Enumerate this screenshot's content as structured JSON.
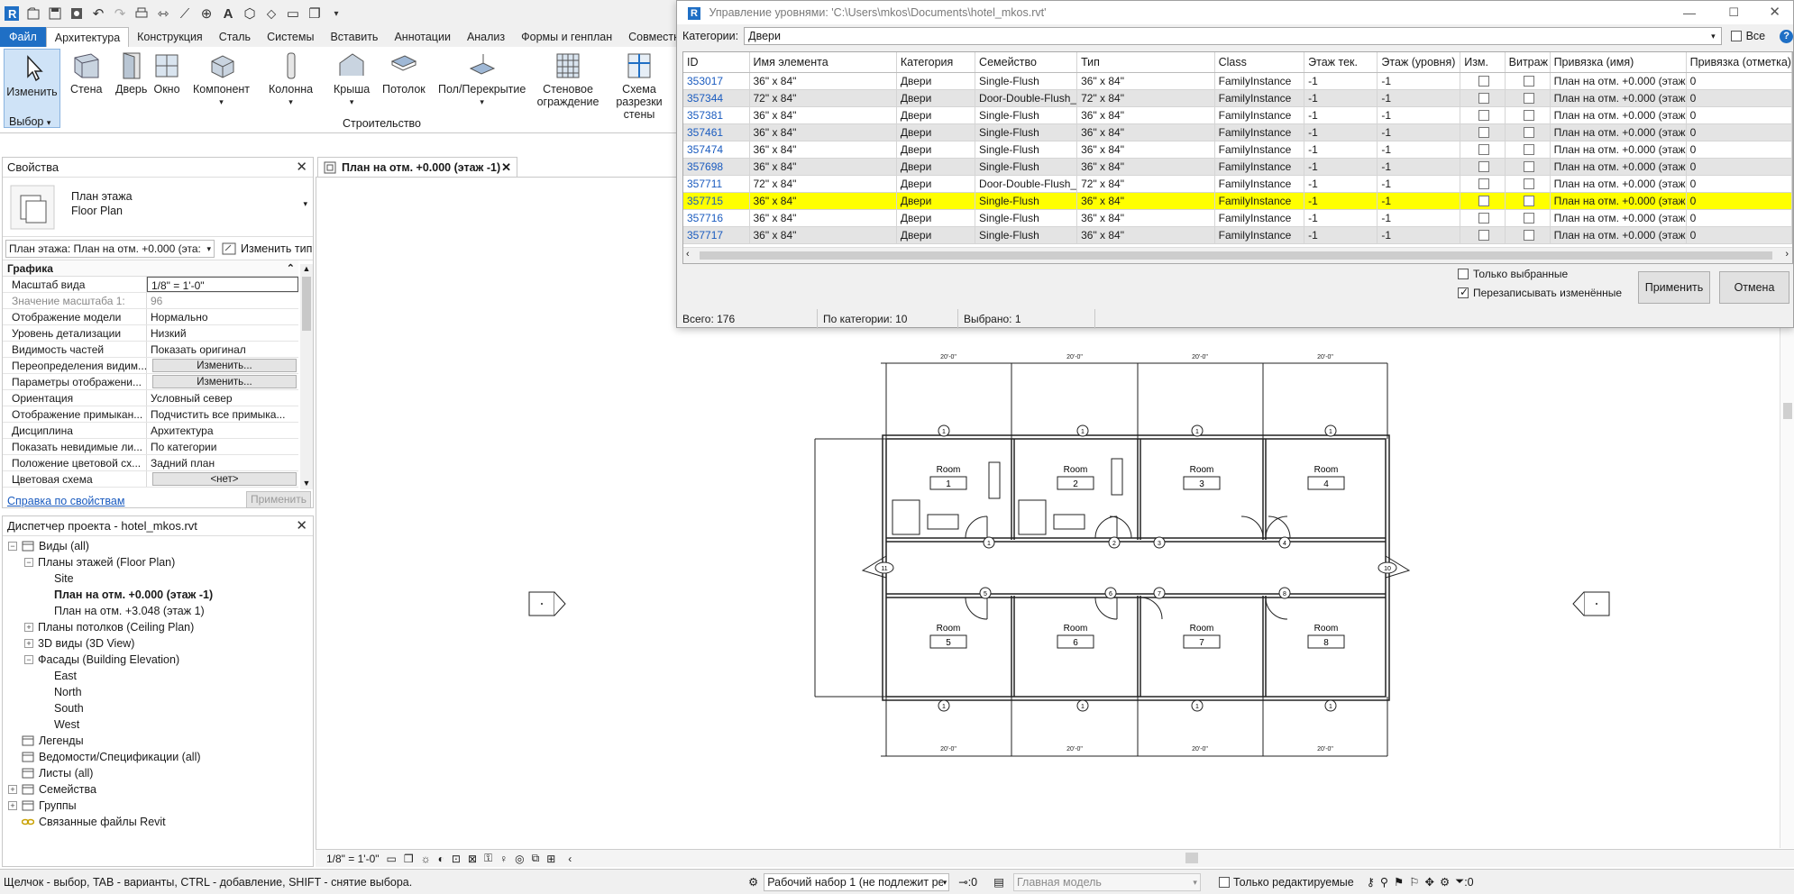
{
  "app": {
    "qat_icons": [
      "revit-logo-icon",
      "open-icon",
      "save-icon",
      "sync-icon",
      "undo-icon",
      "redo-icon",
      "print-icon",
      "measure-icon",
      "dimension-icon",
      "text-icon",
      "3d-view-icon",
      "section-icon",
      "thin-lines-icon",
      "switch-windows-icon"
    ]
  },
  "ribbon": {
    "tabs": [
      "Файл",
      "Архитектура",
      "Конструкция",
      "Сталь",
      "Системы",
      "Вставить",
      "Аннотации",
      "Анализ",
      "Формы и генплан",
      "Совместна"
    ],
    "active_tab_index": 1,
    "buttons": {
      "modify": "Изменить",
      "wall": "Стена",
      "door": "Дверь",
      "window": "Окно",
      "component": "Компонент",
      "column": "Колонна",
      "roof": "Крыша",
      "ceiling": "Потолок",
      "floor": "Пол/Перекрытие",
      "curtain_wall": "Стеновое ограждение",
      "curtain_grid": "Схема разрезки стены"
    },
    "panel_select": "Выбор",
    "panel_build": "Строительство"
  },
  "properties": {
    "title": "Свойства",
    "type_line1": "План этажа",
    "type_line2": "Floor Plan",
    "instance_selector": "План этажа: План на отм. +0.000 (эта:",
    "edit_type": "Изменить тип",
    "section": "Графика",
    "rows": [
      {
        "k": "Масштаб вида",
        "v": "1/8\" = 1'-0\""
      },
      {
        "k": "Значение масштаба    1:",
        "v": "96"
      },
      {
        "k": "Отображение модели",
        "v": "Нормально"
      },
      {
        "k": "Уровень детализации",
        "v": "Низкий"
      },
      {
        "k": "Видимость частей",
        "v": "Показать оригинал"
      },
      {
        "k": "Переопределения видим...",
        "v": "Изменить..."
      },
      {
        "k": "Параметры отображени...",
        "v": "Изменить..."
      },
      {
        "k": "Ориентация",
        "v": "Условный север"
      },
      {
        "k": "Отображение примыкан...",
        "v": "Подчистить все примыка..."
      },
      {
        "k": "Дисциплина",
        "v": "Архитектура"
      },
      {
        "k": "Показать невидимые ли...",
        "v": "По категории"
      },
      {
        "k": "Положение цветовой сх...",
        "v": "Задний план"
      },
      {
        "k": "Цветовая схема",
        "v": "<нет>"
      }
    ],
    "help_link": "Справка по свойствам",
    "apply": "Применить"
  },
  "browser": {
    "title": "Диспетчер проекта - hotel_mkos.rvt",
    "nodes": [
      {
        "label": "Виды (all)",
        "level": 0,
        "exp": "−"
      },
      {
        "label": "Планы этажей (Floor Plan)",
        "level": 1,
        "exp": "−"
      },
      {
        "label": "Site",
        "level": 2,
        "exp": ""
      },
      {
        "label": "План на отм. +0.000 (этаж -1)",
        "level": 2,
        "exp": "",
        "bold": true
      },
      {
        "label": "План на отм. +3.048 (этаж 1)",
        "level": 2,
        "exp": ""
      },
      {
        "label": "Планы потолков (Ceiling Plan)",
        "level": 1,
        "exp": "+"
      },
      {
        "label": "3D виды (3D View)",
        "level": 1,
        "exp": "+"
      },
      {
        "label": "Фасады (Building Elevation)",
        "level": 1,
        "exp": "−"
      },
      {
        "label": "East",
        "level": 2,
        "exp": ""
      },
      {
        "label": "North",
        "level": 2,
        "exp": ""
      },
      {
        "label": "South",
        "level": 2,
        "exp": ""
      },
      {
        "label": "West",
        "level": 2,
        "exp": ""
      },
      {
        "label": "Легенды",
        "level": 0,
        "exp": "",
        "icon": true
      },
      {
        "label": "Ведомости/Спецификации (all)",
        "level": 0,
        "exp": "",
        "icon": true
      },
      {
        "label": "Листы (all)",
        "level": 0,
        "exp": "",
        "icon": true
      },
      {
        "label": "Семейства",
        "level": 0,
        "exp": "+",
        "icon": true
      },
      {
        "label": "Группы",
        "level": 0,
        "exp": "+",
        "icon": true
      },
      {
        "label": "Связанные файлы Revit",
        "level": 0,
        "exp": "",
        "icon": true
      }
    ]
  },
  "view": {
    "tab_label": "План на отм. +0.000 (этаж -1)",
    "scale": "1/8\" = 1'-0\"",
    "rooms": [
      {
        "name": "Room",
        "num": "1"
      },
      {
        "name": "Room",
        "num": "2"
      },
      {
        "name": "Room",
        "num": "3"
      },
      {
        "name": "Room",
        "num": "4"
      },
      {
        "name": "Room",
        "num": "5"
      },
      {
        "name": "Room",
        "num": "6"
      },
      {
        "name": "Room",
        "num": "7"
      },
      {
        "name": "Room",
        "num": "8"
      }
    ],
    "dim_label": "20'-0\""
  },
  "statusbar": {
    "hint": "Щелчок - выбор, TAB - варианты, CTRL - добавление, SHIFT - снятие выбора.",
    "workset": "Рабочий набор 1 (не подлежит ре",
    "sel_count": ":0",
    "design_option": "Главная модель",
    "editable_only": "Только редактируемые",
    "filter_count": ":0"
  },
  "dialog": {
    "title": "Управление уровнями: 'C:\\Users\\mkos\\Documents\\hotel_mkos.rvt'",
    "category_label": "Категории:",
    "category_value": "Двери",
    "all_label": "Все",
    "columns": [
      "ID",
      "Имя элемента",
      "Категория",
      "Семейство",
      "Тип",
      "Class",
      "Этаж тек.",
      "Этаж (уровня)",
      "Изм.",
      "Витраж",
      "Привязка (имя)",
      "Привязка (отметка)"
    ],
    "rows": [
      [
        "353017",
        "36\" x 84\"",
        "Двери",
        "Single-Flush",
        "36\" x 84\"",
        "FamilyInstance",
        "-1",
        "-1",
        "",
        "",
        "План на отм. +0.000 (этаж",
        "0"
      ],
      [
        "357344",
        "72\" x 84\"",
        "Двери",
        "Door-Double-Flush_",
        "72\" x 84\"",
        "FamilyInstance",
        "-1",
        "-1",
        "",
        "",
        "План на отм. +0.000 (этаж",
        "0"
      ],
      [
        "357381",
        "36\" x 84\"",
        "Двери",
        "Single-Flush",
        "36\" x 84\"",
        "FamilyInstance",
        "-1",
        "-1",
        "",
        "",
        "План на отм. +0.000 (этаж",
        "0"
      ],
      [
        "357461",
        "36\" x 84\"",
        "Двери",
        "Single-Flush",
        "36\" x 84\"",
        "FamilyInstance",
        "-1",
        "-1",
        "",
        "",
        "План на отм. +0.000 (этаж",
        "0"
      ],
      [
        "357474",
        "36\" x 84\"",
        "Двери",
        "Single-Flush",
        "36\" x 84\"",
        "FamilyInstance",
        "-1",
        "-1",
        "",
        "",
        "План на отм. +0.000 (этаж",
        "0"
      ],
      [
        "357698",
        "36\" x 84\"",
        "Двери",
        "Single-Flush",
        "36\" x 84\"",
        "FamilyInstance",
        "-1",
        "-1",
        "",
        "",
        "План на отм. +0.000 (этаж",
        "0"
      ],
      [
        "357711",
        "72\" x 84\"",
        "Двери",
        "Door-Double-Flush_",
        "72\" x 84\"",
        "FamilyInstance",
        "-1",
        "-1",
        "",
        "",
        "План на отм. +0.000 (этаж",
        "0"
      ],
      [
        "357715",
        "36\" x 84\"",
        "Двери",
        "Single-Flush",
        "36\" x 84\"",
        "FamilyInstance",
        "-1",
        "-1",
        "",
        "",
        "План на отм. +0.000 (этаж",
        "0"
      ],
      [
        "357716",
        "36\" x 84\"",
        "Двери",
        "Single-Flush",
        "36\" x 84\"",
        "FamilyInstance",
        "-1",
        "-1",
        "",
        "",
        "План на отм. +0.000 (этаж",
        "0"
      ],
      [
        "357717",
        "36\" x 84\"",
        "Двери",
        "Single-Flush",
        "36\" x 84\"",
        "FamilyInstance",
        "-1",
        "-1",
        "",
        "",
        "План на отм. +0.000 (этаж",
        "0"
      ]
    ],
    "selected_row": 7,
    "only_selected": "Только выбранные",
    "overwrite_changed": "Перезаписывать изменённые",
    "apply": "Применить",
    "cancel": "Отмена",
    "total": "Всего: 176",
    "by_category": "По категории: 10",
    "selected": "Выбрано: 1"
  },
  "colors": {
    "accent": "#1f6fc5",
    "selected_row": "#ffff00",
    "link": "#1a5bbf"
  }
}
